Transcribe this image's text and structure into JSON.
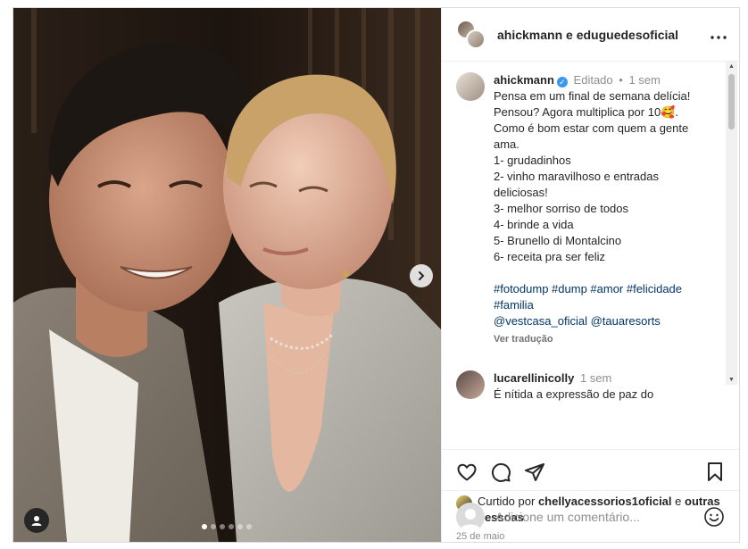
{
  "header": {
    "names": "ahickmann e eduguedesoficial",
    "more_icon": "more-horizontal-icon"
  },
  "caption": {
    "username": "ahickmann",
    "verified_icon": "verified-badge-icon",
    "edited": "Editado",
    "separator": "•",
    "time": "1 sem",
    "lines": [
      "Pensa em um final de semana delícia!",
      "Pensou? Agora multiplica por 10🥰.",
      "Como é bom estar com quem a gente",
      "ama.",
      "1- grudadinhos",
      "2- vinho maravilhoso e entradas",
      "deliciosas!",
      "3- melhor sorriso de todos",
      "4- brinde a vida",
      "5- Brunello di Montalcino",
      "6- receita pra ser feliz"
    ],
    "hashtags_line1": "#fotodump #dump #amor #felicidade",
    "hashtags_line2": "#familia",
    "mentions": "@vestcasa_oficial @tauaresorts",
    "translate": "Ver tradução"
  },
  "comment": {
    "username": "lucarellinicolly",
    "time": "1 sem",
    "text": "É nítida a expressão de paz do"
  },
  "actions": {
    "like_icon": "heart-icon",
    "comment_icon": "comment-icon",
    "share_icon": "send-icon",
    "save_icon": "bookmark-icon"
  },
  "likes": {
    "prefix": "Curtido por",
    "user": "chellyacessorios1oficial",
    "conj": "e",
    "others": "outras pessoas"
  },
  "date": "25 de maio",
  "add_comment": {
    "placeholder": "Adicione um comentário...",
    "emoji_icon": "emoji-smile-icon"
  },
  "carousel": {
    "total": 6,
    "active_index": 0,
    "next_icon": "chevron-right-icon",
    "tag_icon": "user-tag-icon"
  }
}
